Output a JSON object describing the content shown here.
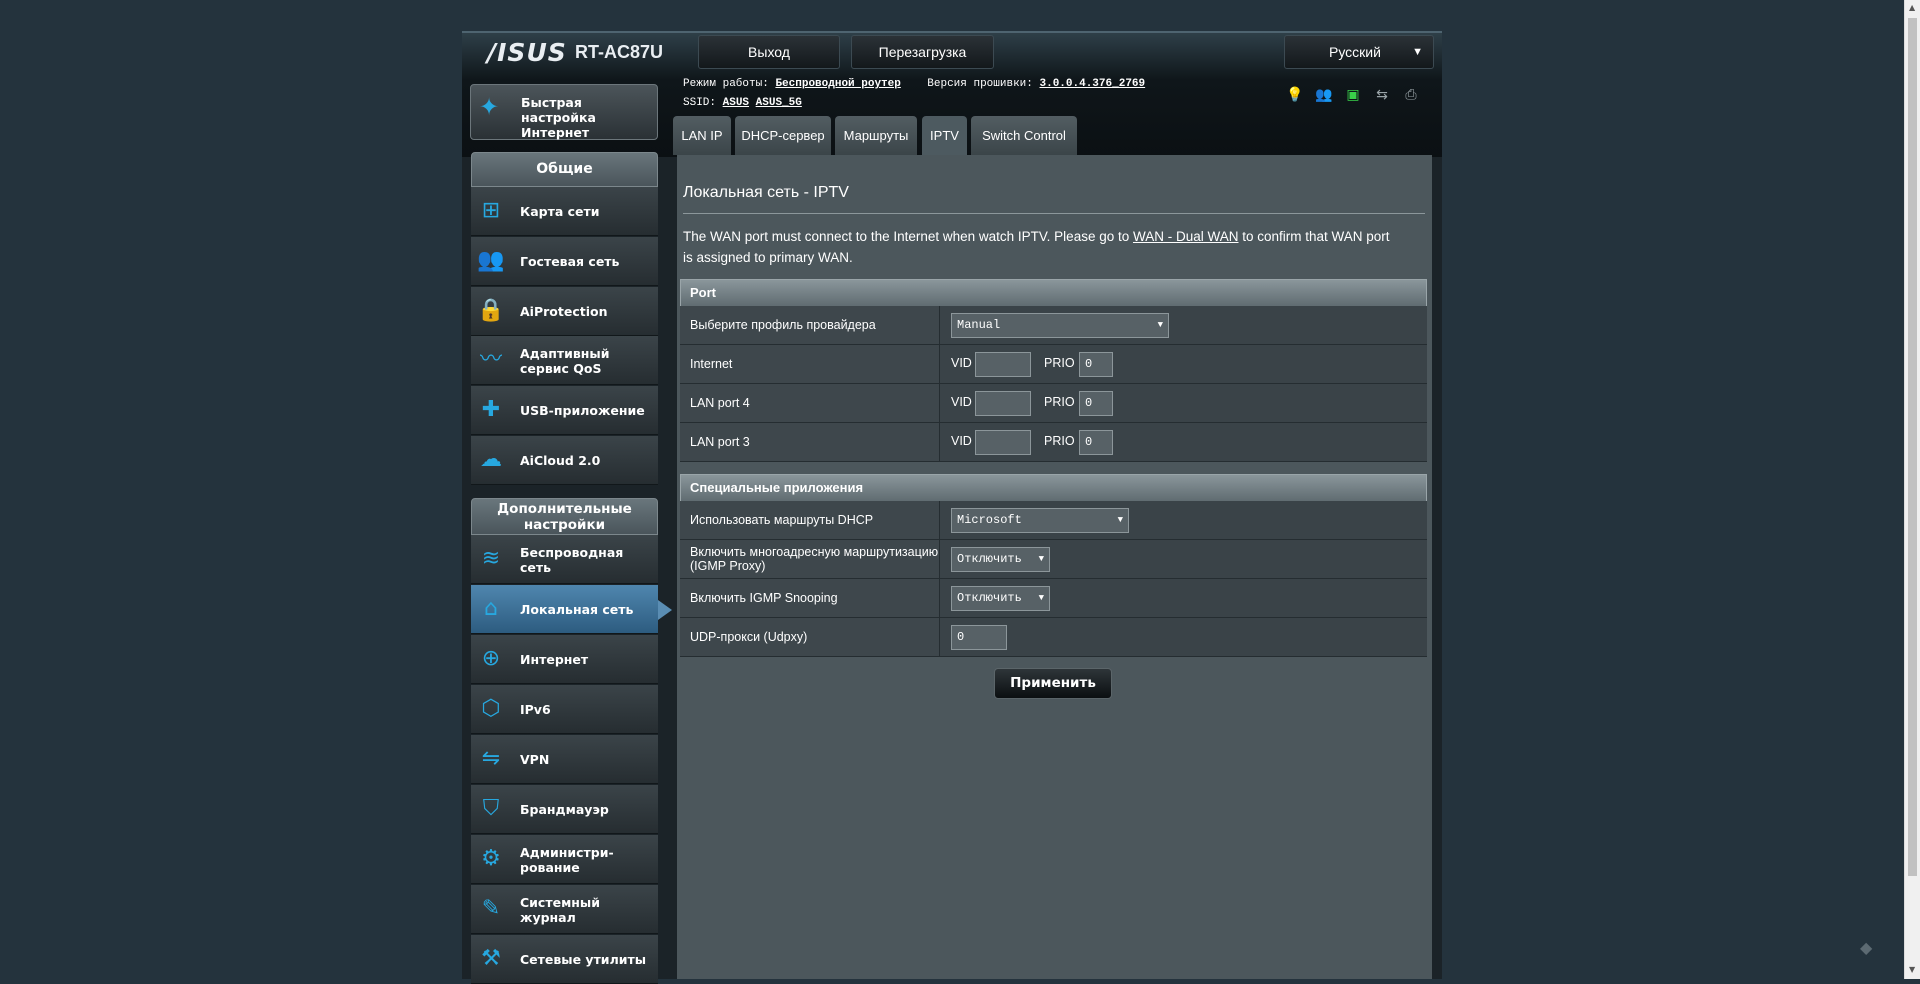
{
  "header": {
    "logo": "/ISUS",
    "model": "RT-AC87U",
    "logout_label": "Выход",
    "reboot_label": "Перезагрузка",
    "language": "Русский",
    "mode_label": "Режим работы:",
    "mode_value": "Беспроводной роутер",
    "firmware_label": "Версия прошивки:",
    "firmware_value": "3.0.0.4.376_2769",
    "ssid_label": "SSID:",
    "ssid_1": "ASUS",
    "ssid_2": "ASUS_5G"
  },
  "sidebar": {
    "quick_setup": "Быстрая настройка Интернет",
    "general_header": "Общие",
    "general_items": [
      {
        "label": "Карта сети",
        "icon": "network-map-icon"
      },
      {
        "label": "Гостевая сеть",
        "icon": "guest-network-icon"
      },
      {
        "label": "AiProtection",
        "icon": "lock-icon"
      },
      {
        "label": "Адаптивный сервис QoS",
        "icon": "qos-icon"
      },
      {
        "label": "USB-приложение",
        "icon": "puzzle-icon"
      },
      {
        "label": "AiCloud 2.0",
        "icon": "cloud-icon"
      }
    ],
    "advanced_header": "Дополнительные настройки",
    "advanced_items": [
      {
        "label": "Беспроводная сеть",
        "icon": "wifi-icon"
      },
      {
        "label": "Локальная сеть",
        "icon": "home-icon"
      },
      {
        "label": "Интернет",
        "icon": "globe-icon"
      },
      {
        "label": "IPv6",
        "icon": "ipv6-icon"
      },
      {
        "label": "VPN",
        "icon": "vpn-icon"
      },
      {
        "label": "Брандмауэр",
        "icon": "shield-icon"
      },
      {
        "label": "Администри-рование",
        "icon": "admin-icon"
      },
      {
        "label": "Системный журнал",
        "icon": "log-icon"
      },
      {
        "label": "Сетевые утилиты",
        "icon": "tools-icon"
      }
    ]
  },
  "tabs": [
    "LAN IP",
    "DHCP-сервер",
    "Маршруты",
    "IPTV",
    "Switch Control"
  ],
  "active_tab": "IPTV",
  "content": {
    "title": "Локальная сеть - IPTV",
    "desc_before": "The WAN port must connect to the Internet when watch IPTV. Please go to ",
    "desc_link": "WAN - Dual WAN",
    "desc_after": " to confirm that WAN port is assigned to primary WAN.",
    "port_section": "Port",
    "profile_label": "Выберите профиль провайдера",
    "profile_value": "Manual",
    "vid_label": "VID",
    "prio_label": "PRIO",
    "port_rows": [
      {
        "label": "Internet",
        "vid": "",
        "prio": "0"
      },
      {
        "label": "LAN port 4",
        "vid": "",
        "prio": "0"
      },
      {
        "label": "LAN port 3",
        "vid": "",
        "prio": "0"
      }
    ],
    "special_section": "Специальные приложения",
    "dhcp_routes_label": "Использовать маршруты DHCP",
    "dhcp_routes_value": "Microsoft",
    "igmp_proxy_label": "Включить многоадресную маршрутизацию (IGMP Proxy)",
    "igmp_proxy_value": "Отключить",
    "igmp_snooping_label": "Включить IGMP Snooping",
    "igmp_snooping_value": "Отключить",
    "udpxy_label": "UDP-прокси (Udpxy)",
    "udpxy_value": "0",
    "apply_label": "Применить"
  },
  "colors": {
    "accent_blue": "#27a8e0",
    "active_nav": "#3e76a0",
    "content_bg": "#4c575c",
    "page_bg": "#24333d"
  }
}
